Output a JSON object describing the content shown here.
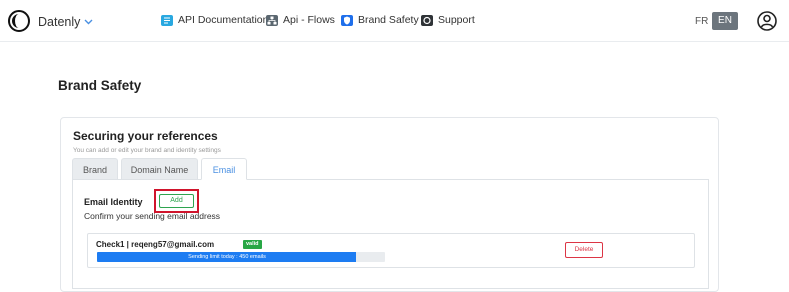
{
  "header": {
    "brand_name": "Datenly",
    "brand_chevron": "chevron-down-icon",
    "nav": [
      {
        "label": "API Documentation",
        "icon": "book-icon",
        "icon_color": "#29a8e0"
      },
      {
        "label": "Api - Flows",
        "icon": "sitemap-icon",
        "icon_color": "#5b6770"
      },
      {
        "label": "Brand Safety",
        "icon": "shield-icon",
        "icon_color": "#1f6feb"
      },
      {
        "label": "Support",
        "icon": "support-icon",
        "icon_color": "#2f3337"
      }
    ],
    "lang_fr": "FR",
    "lang_en": "EN",
    "user_icon": "user-circle-icon"
  },
  "page": {
    "title": "Brand Safety"
  },
  "card": {
    "title": "Securing your references",
    "subtitle": "You can add or edit your brand and identity settings",
    "tabs": [
      {
        "label": "Brand",
        "active": false
      },
      {
        "label": "Domain Name",
        "active": false
      },
      {
        "label": "Email",
        "active": true
      }
    ],
    "email_identity": {
      "label": "Email Identity",
      "add_label": "Add",
      "confirm_text": "Confirm your sending email address"
    },
    "entries": [
      {
        "email": "Check1 | reqeng57@gmail.com",
        "badge": "valid",
        "progress_text": "Sending limit today : 450 emails",
        "progress_fraction": 0.9,
        "delete_label": "Delete"
      }
    ]
  },
  "colors": {
    "accent": "#1d7cf2",
    "success": "#28a745",
    "danger": "#dc3545",
    "highlight_frame": "#d0142c"
  }
}
